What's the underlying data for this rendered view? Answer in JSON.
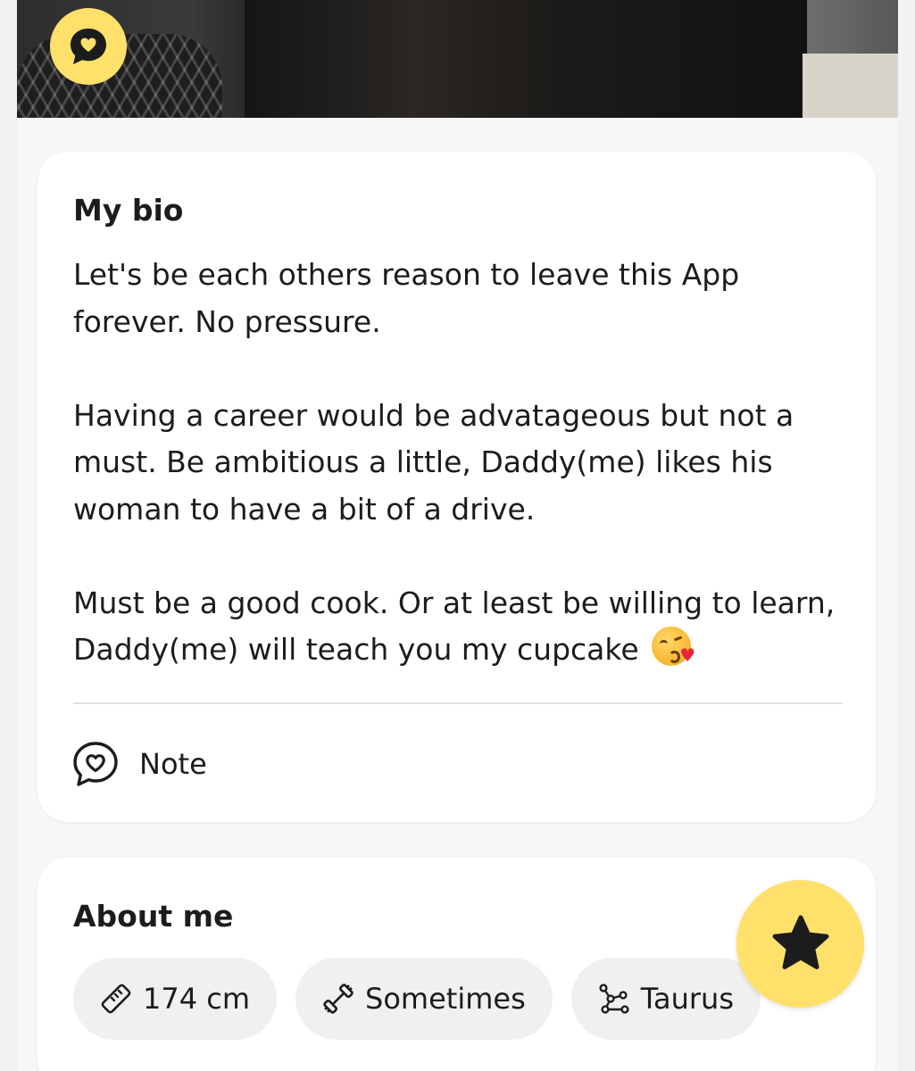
{
  "bio_card": {
    "heading": "My bio",
    "paragraphs": [
      "Let's be each others reason to leave this App forever. No pressure.",
      "Having a career would be advatageous but not a must. Be ambitious a little, Daddy(me) likes his woman to have a bit of a drive.",
      "Must be a good cook. Or at least be willing to learn, Daddy(me) will teach you my cupcake"
    ],
    "emoji": "face-blowing-a-kiss",
    "note_label": "Note"
  },
  "about_card": {
    "heading": "About me",
    "chips": [
      {
        "icon": "ruler-icon",
        "label": "174 cm"
      },
      {
        "icon": "dumbbell-icon",
        "label": "Sometimes"
      },
      {
        "icon": "constellation-icon",
        "label": "Taurus"
      }
    ]
  },
  "icons": {
    "photo_badge": "chat-heart-icon",
    "fab": "star-icon",
    "note": "chat-heart-icon"
  },
  "colors": {
    "accent_yellow": "#ffe06b",
    "card_bg": "#ffffff",
    "page_bg": "#f2f2f2",
    "chip_bg": "#f0f0f0",
    "text": "#1c1c1c"
  }
}
